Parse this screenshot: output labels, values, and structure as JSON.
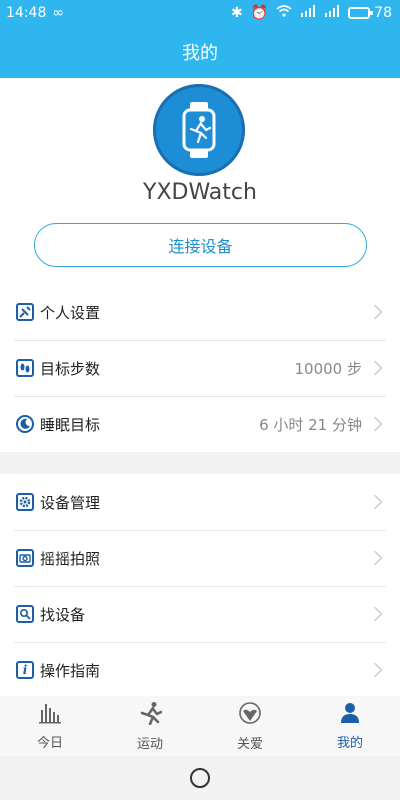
{
  "status_bar": {
    "time": "14:48",
    "battery_percent": "78",
    "battery_fill_fraction": 0.78,
    "icons": [
      "infinity-icon",
      "bluetooth-icon",
      "alarm-icon",
      "wifi-icon",
      "signal-icon",
      "signal-hd-icon",
      "battery-icon"
    ]
  },
  "header": {
    "title": "我的"
  },
  "profile": {
    "device_name": "YXDWatch",
    "connect_label": "连接设备",
    "avatar_icon": "smartwatch-runner-icon"
  },
  "settings_group_1": [
    {
      "name": "personal-settings",
      "label": "个人设置",
      "value": "",
      "icon": "user-edit-icon"
    },
    {
      "name": "step-goal",
      "label": "目标步数",
      "value": "10000 步",
      "icon": "footprints-icon"
    },
    {
      "name": "sleep-goal",
      "label": "睡眠目标",
      "value": "6 小时 21 分钟",
      "icon": "moon-icon"
    }
  ],
  "settings_group_2": [
    {
      "name": "device-management",
      "label": "设备管理",
      "icon": "gear-icon"
    },
    {
      "name": "shake-photo",
      "label": "摇摇拍照",
      "icon": "camera-icon"
    },
    {
      "name": "find-device",
      "label": "找设备",
      "icon": "search-icon"
    },
    {
      "name": "operation-guide",
      "label": "操作指南",
      "icon": "info-icon"
    }
  ],
  "tabs": [
    {
      "label": "今日",
      "icon": "bar-chart-icon",
      "active": false
    },
    {
      "label": "运动",
      "icon": "runner-icon",
      "active": false
    },
    {
      "label": "关爱",
      "icon": "care-icon",
      "active": false
    },
    {
      "label": "我的",
      "icon": "person-icon",
      "active": true
    }
  ],
  "colors": {
    "header": "#2fb6ee",
    "accent": "#1b5fa8",
    "connect_border": "#2fa8df"
  }
}
